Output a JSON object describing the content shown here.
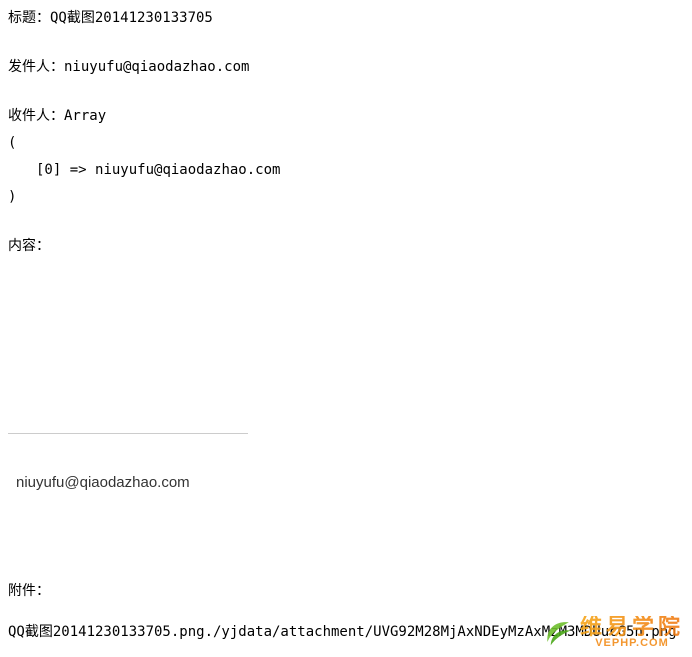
{
  "subject": {
    "label": "标题：",
    "value": "QQ截图20141230133705"
  },
  "from": {
    "label": "发件人：",
    "value": "niuyufu@qiaodazhao.com"
  },
  "to": {
    "label": "收件人：",
    "type": "Array",
    "open": "(",
    "entry_key": "[0]",
    "arrow": " => ",
    "entry_value": "niuyufu@qiaodazhao.com",
    "close": ")"
  },
  "content": {
    "label": "内容："
  },
  "signature_email": "niuyufu@qiaodazhao.com",
  "attachment": {
    "label": "附件：",
    "line": "QQ截图20141230133705.png./yjdata/attachment/UVG92M28MjAxNDEyMzAxMzM3MDUucG5n.png"
  },
  "watermark": {
    "cn": "维易学院",
    "en": "VEPHP.COM"
  }
}
